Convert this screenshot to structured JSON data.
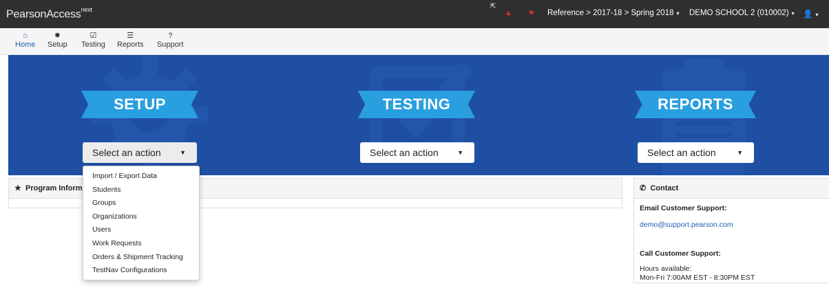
{
  "topbar": {
    "brand": "PearsonAccess",
    "brand_sup": "next",
    "context": "Reference > 2017-18 > Spring 2018",
    "school": "DEMO SCHOOL 2 (010002)",
    "caret": "▾",
    "icons": {
      "bell": "bell-icon",
      "flag": "flag-icon",
      "user": "user-icon"
    },
    "alert_color": "#d9322b"
  },
  "nav": {
    "items": [
      {
        "label": "Home",
        "icon": "home-icon",
        "glyph": "⌂",
        "active": true
      },
      {
        "label": "Setup",
        "icon": "gear-icon",
        "glyph": "✹"
      },
      {
        "label": "Testing",
        "icon": "checkbox-icon",
        "glyph": "☑"
      },
      {
        "label": "Reports",
        "icon": "list-icon",
        "glyph": "☰"
      },
      {
        "label": "Support",
        "icon": "question-icon",
        "glyph": "?"
      }
    ],
    "active_color": "#1a5fb4"
  },
  "hero": {
    "background": "#1f4fa3",
    "ribbon_color": "#2a9fe0",
    "sections": [
      {
        "title": "SETUP",
        "select": "Select an action",
        "bg_icon": "gear-icon"
      },
      {
        "title": "TESTING",
        "select": "Select an action",
        "bg_icon": "checkbox-icon"
      },
      {
        "title": "REPORTS",
        "select": "Select an action",
        "bg_icon": "clipboard-icon"
      }
    ]
  },
  "setup_menu": {
    "items": [
      "Import / Export Data",
      "Students",
      "Groups",
      "Organizations",
      "Users",
      "Work Requests",
      "Orders & Shipment Tracking",
      "TestNav Configurations"
    ]
  },
  "program_panel": {
    "title": "Program Inform",
    "icon": "star-icon"
  },
  "contact": {
    "title": "Contact",
    "icon": "phone-icon",
    "email_label": "Email Customer Support:",
    "email": "demo@support.pearson.com",
    "call_label": "Call Customer Support:",
    "hours_label": "Hours available:",
    "hours": "Mon-Fri 7:00AM EST - 8:30PM EST"
  }
}
